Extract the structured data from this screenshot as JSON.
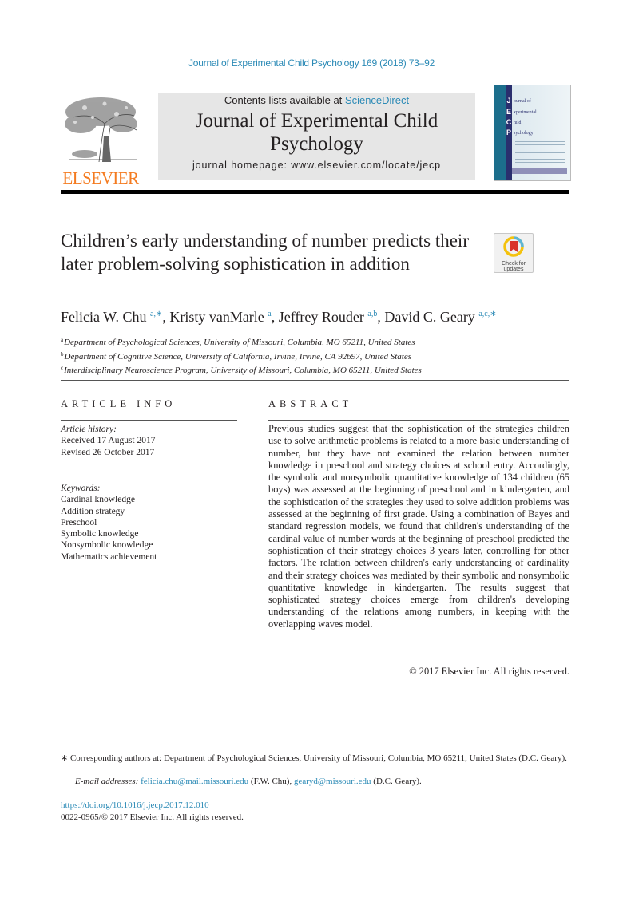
{
  "running_head": "Journal of Experimental Child Psychology 169 (2018) 73–92",
  "masthead": {
    "publisher_logo_text": "ELSEVIER",
    "contents_prefix": "Contents lists available at ",
    "contents_link": "ScienceDirect",
    "journal_title": "Journal of Experimental Child Psychology",
    "homepage": "journal homepage: www.elsevier.com/locate/jecp",
    "cover": {
      "letters": [
        "J",
        "E",
        "C",
        "P"
      ],
      "words": [
        "ournal of",
        "xperimental",
        "hild",
        "sychology"
      ]
    }
  },
  "colors": {
    "link": "#2b8ab6",
    "elsevier_orange": "#f47b20",
    "masthead_bg": "#e6e6e6"
  },
  "article": {
    "title": "Children’s early understanding of number predicts their later problem-solving sophistication in addition",
    "check_updates_label_1": "Check for",
    "check_updates_label_2": "updates",
    "authors": [
      {
        "name": "Felicia W. Chu",
        "sup": "a,∗",
        "sep": ", "
      },
      {
        "name": "Kristy vanMarle",
        "sup": "a",
        "sep": ", "
      },
      {
        "name": "Jeffrey Rouder",
        "sup": "a,b",
        "sep": ", "
      },
      {
        "name": "David C. Geary",
        "sup": "a,c,∗",
        "sep": ""
      }
    ],
    "affiliations": [
      {
        "key": "a",
        "text": "Department of Psychological Sciences, University of Missouri, Columbia, MO 65211, United States"
      },
      {
        "key": "b",
        "text": "Department of Cognitive Science, University of California, Irvine, Irvine, CA 92697, United States"
      },
      {
        "key": "c",
        "text": "Interdisciplinary Neuroscience Program, University of Missouri, Columbia, MO 65211, United States"
      }
    ]
  },
  "article_info": {
    "heading": "ARTICLE INFO",
    "history_label": "Article history:",
    "received": "Received 17 August 2017",
    "revised": "Revised 26 October 2017",
    "keywords_label": "Keywords:",
    "keywords": [
      "Cardinal knowledge",
      "Addition strategy",
      "Preschool",
      "Symbolic knowledge",
      "Nonsymbolic knowledge",
      "Mathematics achievement"
    ]
  },
  "abstract": {
    "heading": "ABSTRACT",
    "text": "Previous studies suggest that the sophistication of the strategies children use to solve arithmetic problems is related to a more basic understanding of number, but they have not examined the relation between number knowledge in preschool and strategy choices at school entry. Accordingly, the symbolic and nonsymbolic quantita­tive knowledge of 134 children (65 boys) was assessed at the beginning of preschool and in kindergarten, and the sophistication of the strategies they used to solve addition problems was assessed at the beginning of first grade. Using a combination of Bayes and standard regression models, we found that children's understand­ing of the cardinal value of number words at the beginning of pre­school predicted the sophistication of their strategy choices 3 years later, controlling for other factors. The relation between children's early understanding of cardinality and their strategy choices was mediated by their symbolic and nonsymbolic quantitative knowl­edge in kindergarten. The results suggest that sophisticated strat­egy choices emerge from children's developing understanding of the relations among numbers, in keeping with the overlapping waves model.",
    "copyright": "© 2017 Elsevier Inc. All rights reserved."
  },
  "footnotes": {
    "corresponding": "∗ Corresponding authors at: Department of Psychological Sciences, University of Missouri, Columbia, MO 65211, United States (D.C. Geary).",
    "email_label": "E-mail addresses:",
    "email_1": "felicia.chu@mail.missouri.edu",
    "email_1_owner": " (F.W. Chu), ",
    "email_2": "gearyd@missouri.edu",
    "email_2_owner": " (D.C. Geary).",
    "doi": "https://doi.org/10.1016/j.jecp.2017.12.010",
    "issn": "0022-0965/© 2017 Elsevier Inc. All rights reserved."
  }
}
